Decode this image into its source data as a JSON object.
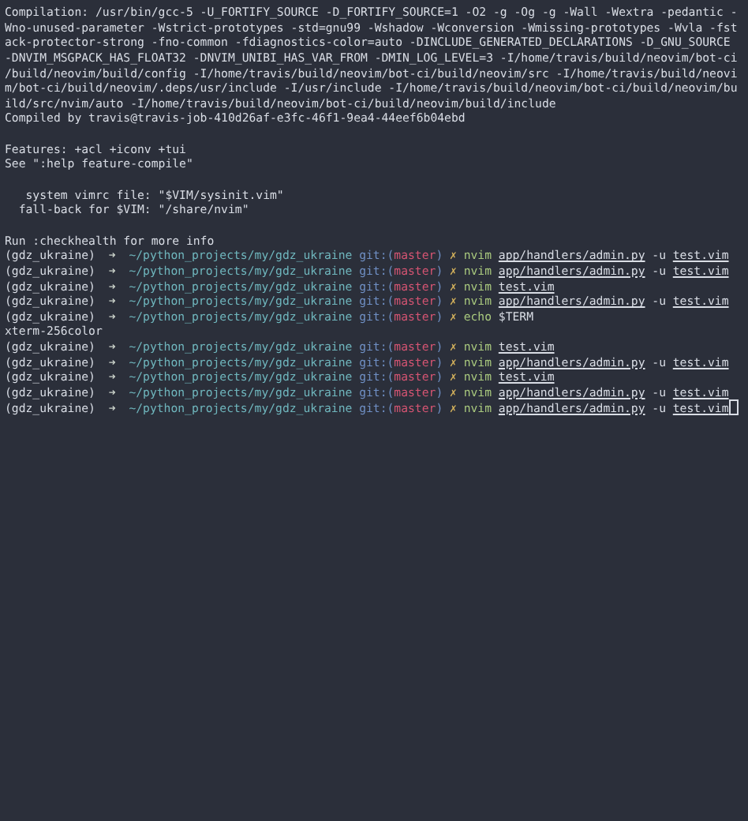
{
  "terminal": {
    "blocks": [
      {
        "lines": [
          {
            "kind": "output",
            "text": "Compilation: /usr/bin/gcc-5 -U_FORTIFY_SOURCE -D_FORTIFY_SOURCE=1 -O2 -g -Og -g -Wall -Wextra -pedantic -"
          },
          {
            "kind": "output",
            "text": "Wno-unused-parameter -Wstrict-prototypes -std=gnu99 -Wshadow -Wconversion -Wmissing-prototypes -Wvla -fst"
          },
          {
            "kind": "output",
            "text": "ack-protector-strong -fno-common -fdiagnostics-color=auto -DINCLUDE_GENERATED_DECLARATIONS -D_GNU_SOURCE"
          },
          {
            "kind": "output",
            "text": "-DNVIM_MSGPACK_HAS_FLOAT32 -DNVIM_UNIBI_HAS_VAR_FROM -DMIN_LOG_LEVEL=3 -I/home/travis/build/neovim/bot-ci"
          },
          {
            "kind": "output",
            "text": "/build/neovim/build/config -I/home/travis/build/neovim/bot-ci/build/neovim/src -I/home/travis/build/neovi"
          },
          {
            "kind": "output",
            "text": "m/bot-ci/build/neovim/.deps/usr/include -I/usr/include -I/home/travis/build/neovim/bot-ci/build/neovim/bu"
          },
          {
            "kind": "output",
            "text": "ild/src/nvim/auto -I/home/travis/build/neovim/bot-ci/build/neovim/build/include"
          },
          {
            "kind": "output",
            "text": "Compiled by travis@travis-job-410d26af-e3fc-46f1-9ea4-44eef6b04ebd"
          }
        ]
      },
      {
        "lines": [
          {
            "kind": "output",
            "text": "Features: +acl +iconv +tui"
          },
          {
            "kind": "output",
            "text": "See \":help feature-compile\""
          }
        ]
      },
      {
        "lines": [
          {
            "kind": "output",
            "text": "   system vimrc file: \"$VIM/sysinit.vim\""
          },
          {
            "kind": "output",
            "text": "  fall-back for $VIM: \"/share/nvim\""
          }
        ]
      },
      {
        "lines": [
          {
            "kind": "output",
            "text": "Run :checkhealth for more info"
          },
          {
            "kind": "prompt",
            "env": "(gdz_ukraine)",
            "arrow": "➜",
            "path": "~/python_projects/my/gdz_ukraine",
            "git": "git:(",
            "branch": "master",
            "git_close": ")",
            "dirty": "✗",
            "command": "nvim",
            "args": [
              {
                "text": "app/handlers/admin.py",
                "underlined": true
              },
              {
                "text": "-u",
                "underlined": false
              },
              {
                "text": "test.vim",
                "underlined": true
              }
            ],
            "cursor": false
          },
          {
            "kind": "prompt",
            "env": "(gdz_ukraine)",
            "arrow": "➜",
            "path": "~/python_projects/my/gdz_ukraine",
            "git": "git:(",
            "branch": "master",
            "git_close": ")",
            "dirty": "✗",
            "command": "nvim",
            "args": [
              {
                "text": "app/handlers/admin.py",
                "underlined": true
              },
              {
                "text": "-u",
                "underlined": false
              },
              {
                "text": "test.vim",
                "underlined": true
              }
            ],
            "cursor": false
          },
          {
            "kind": "prompt",
            "env": "(gdz_ukraine)",
            "arrow": "➜",
            "path": "~/python_projects/my/gdz_ukraine",
            "git": "git:(",
            "branch": "master",
            "git_close": ")",
            "dirty": "✗",
            "command": "nvim",
            "args": [
              {
                "text": "test.vim",
                "underlined": true
              }
            ],
            "cursor": false
          },
          {
            "kind": "prompt",
            "env": "(gdz_ukraine)",
            "arrow": "➜",
            "path": "~/python_projects/my/gdz_ukraine",
            "git": "git:(",
            "branch": "master",
            "git_close": ")",
            "dirty": "✗",
            "command": "nvim",
            "args": [
              {
                "text": "app/handlers/admin.py",
                "underlined": true
              },
              {
                "text": "-u",
                "underlined": false
              },
              {
                "text": "test.vim",
                "underlined": true
              }
            ],
            "cursor": false
          },
          {
            "kind": "prompt",
            "env": "(gdz_ukraine)",
            "arrow": "➜",
            "path": "~/python_projects/my/gdz_ukraine",
            "git": "git:(",
            "branch": "master",
            "git_close": ")",
            "dirty": "✗",
            "command": "echo",
            "args": [
              {
                "text": "$TERM",
                "underlined": false
              }
            ],
            "cursor": false
          },
          {
            "kind": "output",
            "text": "xterm-256color"
          },
          {
            "kind": "prompt",
            "env": "(gdz_ukraine)",
            "arrow": "➜",
            "path": "~/python_projects/my/gdz_ukraine",
            "git": "git:(",
            "branch": "master",
            "git_close": ")",
            "dirty": "✗",
            "command": "nvim",
            "args": [
              {
                "text": "test.vim",
                "underlined": true
              }
            ],
            "cursor": false
          },
          {
            "kind": "prompt",
            "env": "(gdz_ukraine)",
            "arrow": "➜",
            "path": "~/python_projects/my/gdz_ukraine",
            "git": "git:(",
            "branch": "master",
            "git_close": ")",
            "dirty": "✗",
            "command": "nvim",
            "args": [
              {
                "text": "app/handlers/admin.py",
                "underlined": true
              },
              {
                "text": "-u",
                "underlined": false
              },
              {
                "text": "test.vim",
                "underlined": true
              }
            ],
            "cursor": false
          },
          {
            "kind": "prompt",
            "env": "(gdz_ukraine)",
            "arrow": "➜",
            "path": "~/python_projects/my/gdz_ukraine",
            "git": "git:(",
            "branch": "master",
            "git_close": ")",
            "dirty": "✗",
            "command": "nvim",
            "args": [
              {
                "text": "test.vim",
                "underlined": true
              }
            ],
            "cursor": false
          },
          {
            "kind": "prompt",
            "env": "(gdz_ukraine)",
            "arrow": "➜",
            "path": "~/python_projects/my/gdz_ukraine",
            "git": "git:(",
            "branch": "master",
            "git_close": ")",
            "dirty": "✗",
            "command": "nvim",
            "args": [
              {
                "text": "app/handlers/admin.py",
                "underlined": true
              },
              {
                "text": "-u",
                "underlined": false
              },
              {
                "text": "test.vim",
                "underlined": true
              }
            ],
            "cursor": false
          },
          {
            "kind": "prompt",
            "env": "(gdz_ukraine)",
            "arrow": "➜",
            "path": "~/python_projects/my/gdz_ukraine",
            "git": "git:(",
            "branch": "master",
            "git_close": ")",
            "dirty": "✗",
            "command": "nvim",
            "args": [
              {
                "text": "app/handlers/admin.py",
                "underlined": true
              },
              {
                "text": "-u",
                "underlined": false
              },
              {
                "text": "test.vim",
                "underlined": true
              }
            ],
            "cursor": true
          }
        ]
      }
    ]
  }
}
